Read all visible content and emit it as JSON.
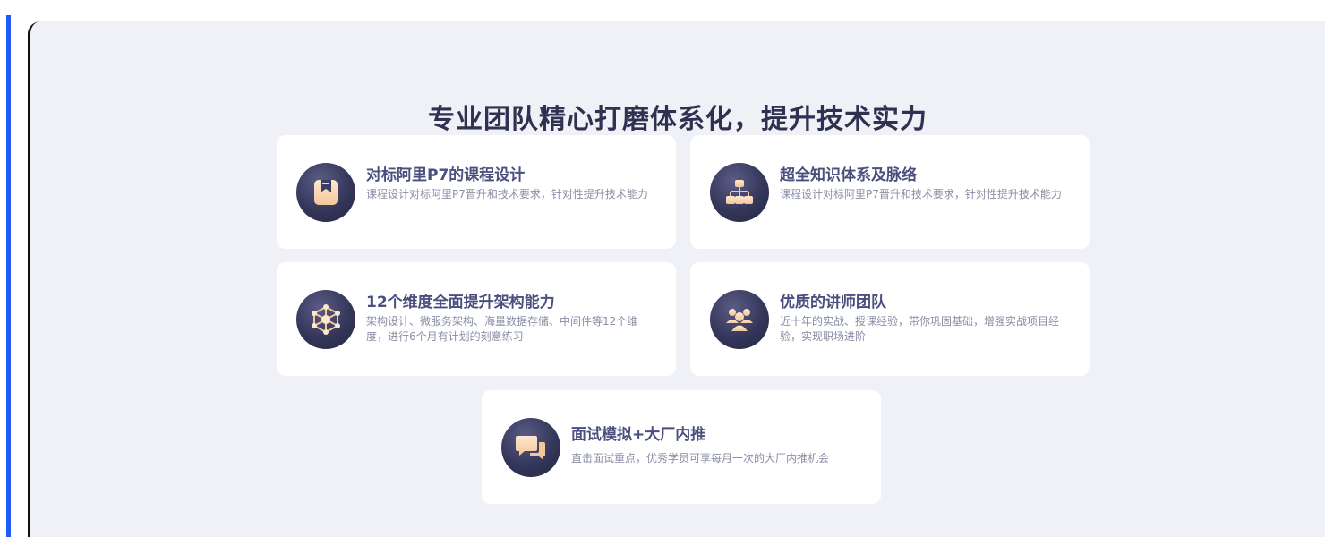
{
  "page_title": "专业团队精心打磨体系化，提升技术实力",
  "cards": [
    {
      "title": "对标阿里P7的课程设计",
      "desc": "课程设计对标阿里P7晋升和技术要求，针对性提升技术能力",
      "icon": "bookmark-icon"
    },
    {
      "title": "超全知识体系及脉络",
      "desc": "课程设计对标阿里P7晋升和技术要求，针对性提升技术能力",
      "icon": "hierarchy-icon"
    },
    {
      "title": "12个维度全面提升架构能力",
      "desc": "架构设计、微服务架构、海量数据存储、中间件等12个维度，进行6个月有计划的刻意练习",
      "icon": "network-icon"
    },
    {
      "title": "优质的讲师团队",
      "desc": "近十年的实战、授课经验，带你巩固基础，增强实战项目经验，实现职场进阶",
      "icon": "team-icon"
    },
    {
      "title": "面试模拟+大厂内推",
      "desc": "直击面试重点，优秀学员可享每月一次的大厂内推机会",
      "icon": "chat-icon"
    }
  ],
  "colors": {
    "accent_bar": "#1f5af5",
    "panel_bg": "#f0f1f7",
    "title": "#2f3150",
    "card_title": "#4a4f7d",
    "icon_glyph": "#f7d8b8"
  }
}
